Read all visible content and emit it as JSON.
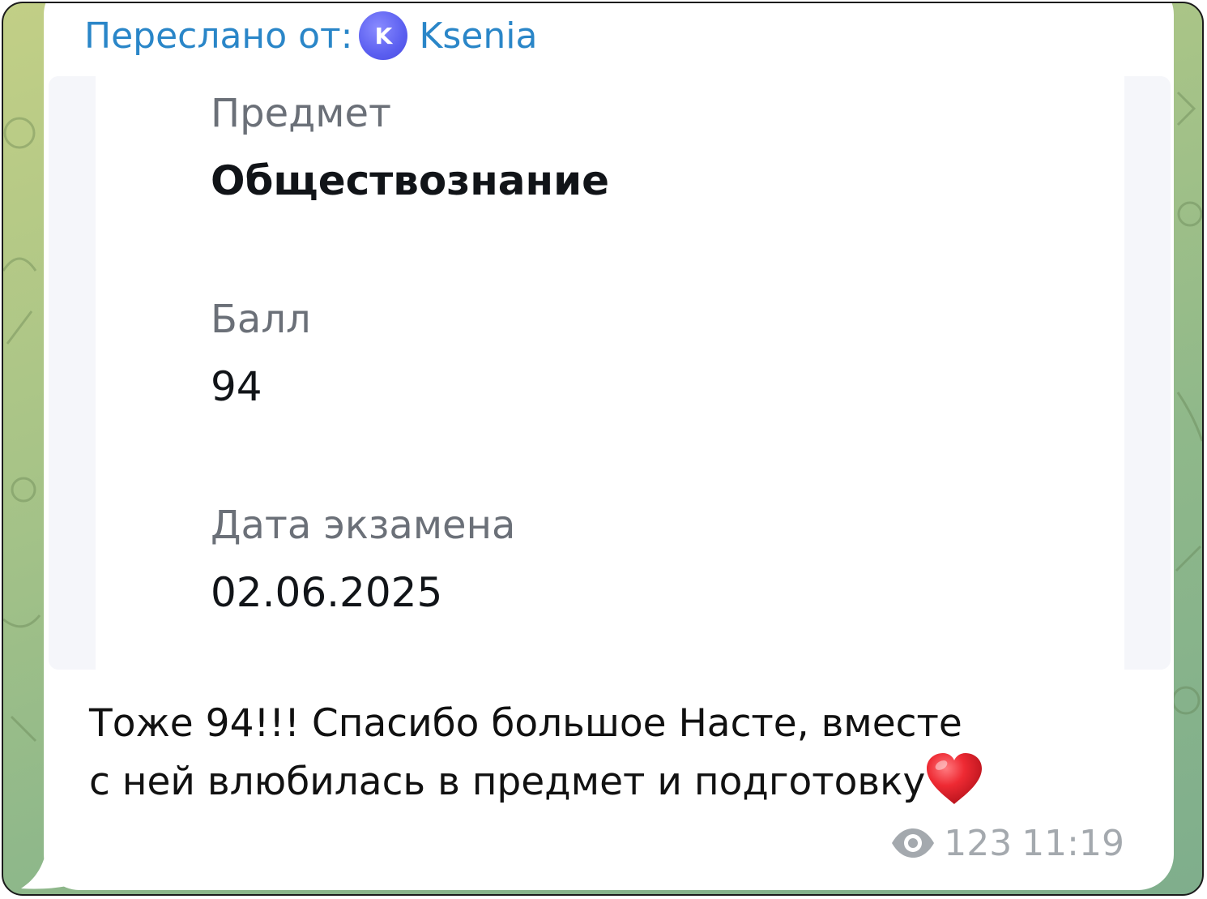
{
  "forward": {
    "prefix": "Переслано от:",
    "avatar_letter": "K",
    "sender_name": "Ksenia"
  },
  "result_card": {
    "subject_label": "Предмет",
    "subject_value": "Обществознание",
    "score_label": "Балл",
    "score_value": "94",
    "date_label": "Дата экзамена",
    "date_value": "02.06.2025"
  },
  "message": {
    "line1": "Тоже 94!!! Спасибо большое Насте, вместе",
    "line2": "с ней влюбилась в предмет и подготовку",
    "emoji": "heart-emoji"
  },
  "meta": {
    "views_icon": "eye-icon",
    "views": "123",
    "time": "11:19"
  },
  "colors": {
    "link": "#2a86c8",
    "meta": "#a4a9ae",
    "heart": "#e8232b"
  }
}
